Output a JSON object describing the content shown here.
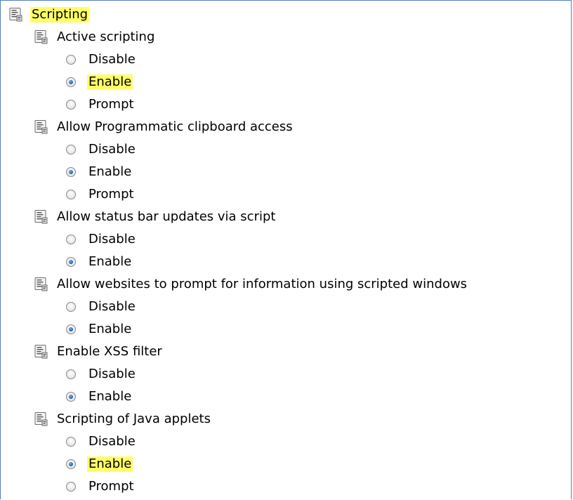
{
  "root": {
    "label": "Scripting",
    "icon": "group-policy-icon",
    "highlighted": true
  },
  "settings": [
    {
      "name": "Active scripting",
      "icon": "group-policy-icon",
      "options": [
        {
          "label": "Disable",
          "checked": false,
          "highlighted": false
        },
        {
          "label": "Enable",
          "checked": true,
          "highlighted": true
        },
        {
          "label": "Prompt",
          "checked": false,
          "highlighted": false
        }
      ]
    },
    {
      "name": "Allow Programmatic clipboard access",
      "icon": "group-policy-icon",
      "options": [
        {
          "label": "Disable",
          "checked": false,
          "highlighted": false
        },
        {
          "label": "Enable",
          "checked": true,
          "highlighted": false
        },
        {
          "label": "Prompt",
          "checked": false,
          "highlighted": false
        }
      ]
    },
    {
      "name": "Allow status bar updates via script",
      "icon": "group-policy-icon",
      "options": [
        {
          "label": "Disable",
          "checked": false,
          "highlighted": false
        },
        {
          "label": "Enable",
          "checked": true,
          "highlighted": false
        }
      ]
    },
    {
      "name": "Allow websites to prompt for information using scripted windows",
      "icon": "group-policy-icon",
      "options": [
        {
          "label": "Disable",
          "checked": false,
          "highlighted": false
        },
        {
          "label": "Enable",
          "checked": true,
          "highlighted": false
        }
      ]
    },
    {
      "name": "Enable XSS filter",
      "icon": "group-policy-icon",
      "options": [
        {
          "label": "Disable",
          "checked": false,
          "highlighted": false
        },
        {
          "label": "Enable",
          "checked": true,
          "highlighted": false
        }
      ]
    },
    {
      "name": "Scripting of Java applets",
      "icon": "group-policy-icon",
      "options": [
        {
          "label": "Disable",
          "checked": false,
          "highlighted": false
        },
        {
          "label": "Enable",
          "checked": true,
          "highlighted": true
        },
        {
          "label": "Prompt",
          "checked": false,
          "highlighted": false
        }
      ]
    }
  ],
  "colors": {
    "highlight": "#ffff66",
    "border": "#4f7fbf",
    "radio_selected": "#1a5fa8"
  }
}
